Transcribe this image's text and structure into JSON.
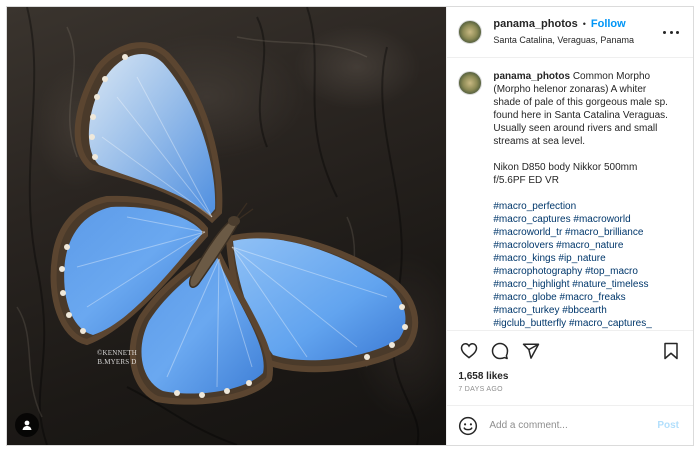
{
  "post": {
    "author": {
      "username": "panama_photos",
      "location": "Santa Catalina, Veraguas, Panama",
      "follow_label": "Follow",
      "separator": "•"
    },
    "photo": {
      "watermark_line1": "©KENNETH",
      "watermark_line2": "B.MYERS D"
    },
    "caption": {
      "username": "panama_photos",
      "body": " Common Morpho (Morpho helenor zonaras) A whiter shade of pale of this gorgeous male sp. found here in Santa Catalina Veraguas. Usually seen around rivers and small streams at sea level.",
      "gear": "Nikon D850 body Nikkor 500mm f/5.6PF ED VR",
      "hashtags": "#macro_perfection\n#macro_captures #macroworld\n#macroworld_tr #macro_brilliance\n#macrolovers #macro_nature\n#macro_kings #ip_nature\n#macrophotography #top_macro\n#macro_highlight #nature_timeless\n#macro_globe #macro_freaks\n#macro_turkey #bbcearth\n#igclub_butterfly #macro_captures_"
    },
    "stats": {
      "likes": "1,658 likes",
      "time": "7 DAYS AGO"
    },
    "comment": {
      "placeholder": "Add a comment...",
      "post_label": "Post"
    },
    "colors": {
      "link_blue": "#0095f6",
      "hashtag": "#00376b",
      "post_disabled": "#b2dffc",
      "muted": "#8e8e8e"
    },
    "icons": {
      "like": "heart-icon",
      "comment": "comment-icon",
      "share": "paper-plane-icon",
      "save": "bookmark-icon",
      "more": "more-horizontal-icon",
      "emoji": "smiley-icon",
      "tagged": "user-tag-icon"
    }
  }
}
